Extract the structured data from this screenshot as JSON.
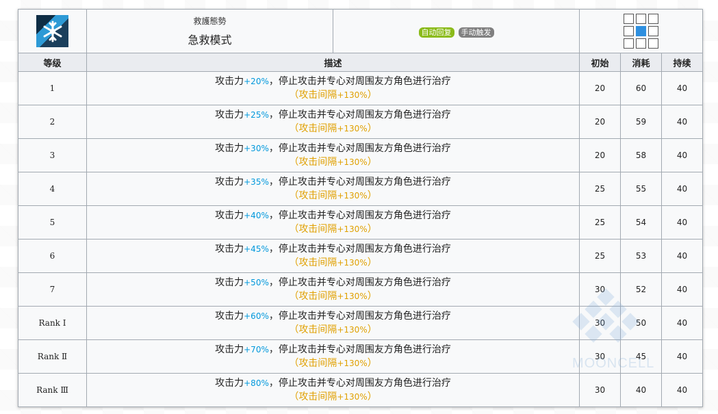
{
  "skill": {
    "subtitle": "救護態勢",
    "name": "急救模式",
    "tags": [
      "自动回复",
      "手动触发"
    ],
    "colors": {
      "tag_recover": "#8bbb1a",
      "tag_manual": "#808080",
      "range_active": "#2e8fdf"
    },
    "range": [
      [
        0,
        0,
        0
      ],
      [
        0,
        1,
        0
      ],
      [
        0,
        0,
        0
      ]
    ]
  },
  "columns": {
    "level": "等级",
    "desc": "描述",
    "init": "初始",
    "cost": "消耗",
    "duration": "持续"
  },
  "rows": [
    {
      "level": "1",
      "prefix": "攻击力",
      "bonus": "+20%",
      "suffix": "，停止攻击并专心对周围友方角色进行治疗",
      "note_open": "（",
      "note_cn": "攻击间隔",
      "note_val": "+130%",
      "note_close": "）",
      "init": "20",
      "cost": "60",
      "duration": "40"
    },
    {
      "level": "2",
      "prefix": "攻击力",
      "bonus": "+25%",
      "suffix": "，停止攻击并专心对周围友方角色进行治疗",
      "note_open": "（",
      "note_cn": "攻击间隔",
      "note_val": "+130%",
      "note_close": "）",
      "init": "20",
      "cost": "59",
      "duration": "40"
    },
    {
      "level": "3",
      "prefix": "攻击力",
      "bonus": "+30%",
      "suffix": "，停止攻击并专心对周围友方角色进行治疗",
      "note_open": "（",
      "note_cn": "攻击间隔",
      "note_val": "+130%",
      "note_close": "）",
      "init": "20",
      "cost": "58",
      "duration": "40"
    },
    {
      "level": "4",
      "prefix": "攻击力",
      "bonus": "+35%",
      "suffix": "，停止攻击并专心对周围友方角色进行治疗",
      "note_open": "（",
      "note_cn": "攻击间隔",
      "note_val": "+130%",
      "note_close": "）",
      "init": "25",
      "cost": "55",
      "duration": "40"
    },
    {
      "level": "5",
      "prefix": "攻击力",
      "bonus": "+40%",
      "suffix": "，停止攻击并专心对周围友方角色进行治疗",
      "note_open": "（",
      "note_cn": "攻击间隔",
      "note_val": "+130%",
      "note_close": "）",
      "init": "25",
      "cost": "54",
      "duration": "40"
    },
    {
      "level": "6",
      "prefix": "攻击力",
      "bonus": "+45%",
      "suffix": "，停止攻击并专心对周围友方角色进行治疗",
      "note_open": "（",
      "note_cn": "攻击间隔",
      "note_val": "+130%",
      "note_close": "）",
      "init": "25",
      "cost": "53",
      "duration": "40"
    },
    {
      "level": "7",
      "prefix": "攻击力",
      "bonus": "+50%",
      "suffix": "，停止攻击并专心对周围友方角色进行治疗",
      "note_open": "（",
      "note_cn": "攻击间隔",
      "note_val": "+130%",
      "note_close": "）",
      "init": "30",
      "cost": "52",
      "duration": "40"
    },
    {
      "level": "Rank Ⅰ",
      "prefix": "攻击力",
      "bonus": "+60%",
      "suffix": "，停止攻击并专心对周围友方角色进行治疗",
      "note_open": "（",
      "note_cn": "攻击间隔",
      "note_val": "+130%",
      "note_close": "）",
      "init": "30",
      "cost": "50",
      "duration": "40"
    },
    {
      "level": "Rank Ⅱ",
      "prefix": "攻击力",
      "bonus": "+70%",
      "suffix": "，停止攻击并专心对周围友方角色进行治疗",
      "note_open": "（",
      "note_cn": "攻击间隔",
      "note_val": "+130%",
      "note_close": "）",
      "init": "30",
      "cost": "45",
      "duration": "40"
    },
    {
      "level": "Rank Ⅲ",
      "prefix": "攻击力",
      "bonus": "+80%",
      "suffix": "，停止攻击并专心对周围友方角色进行治疗",
      "note_open": "（",
      "note_cn": "攻击间隔",
      "note_val": "+130%",
      "note_close": "）",
      "init": "30",
      "cost": "40",
      "duration": "40"
    }
  ],
  "watermark": "MOONCELL"
}
